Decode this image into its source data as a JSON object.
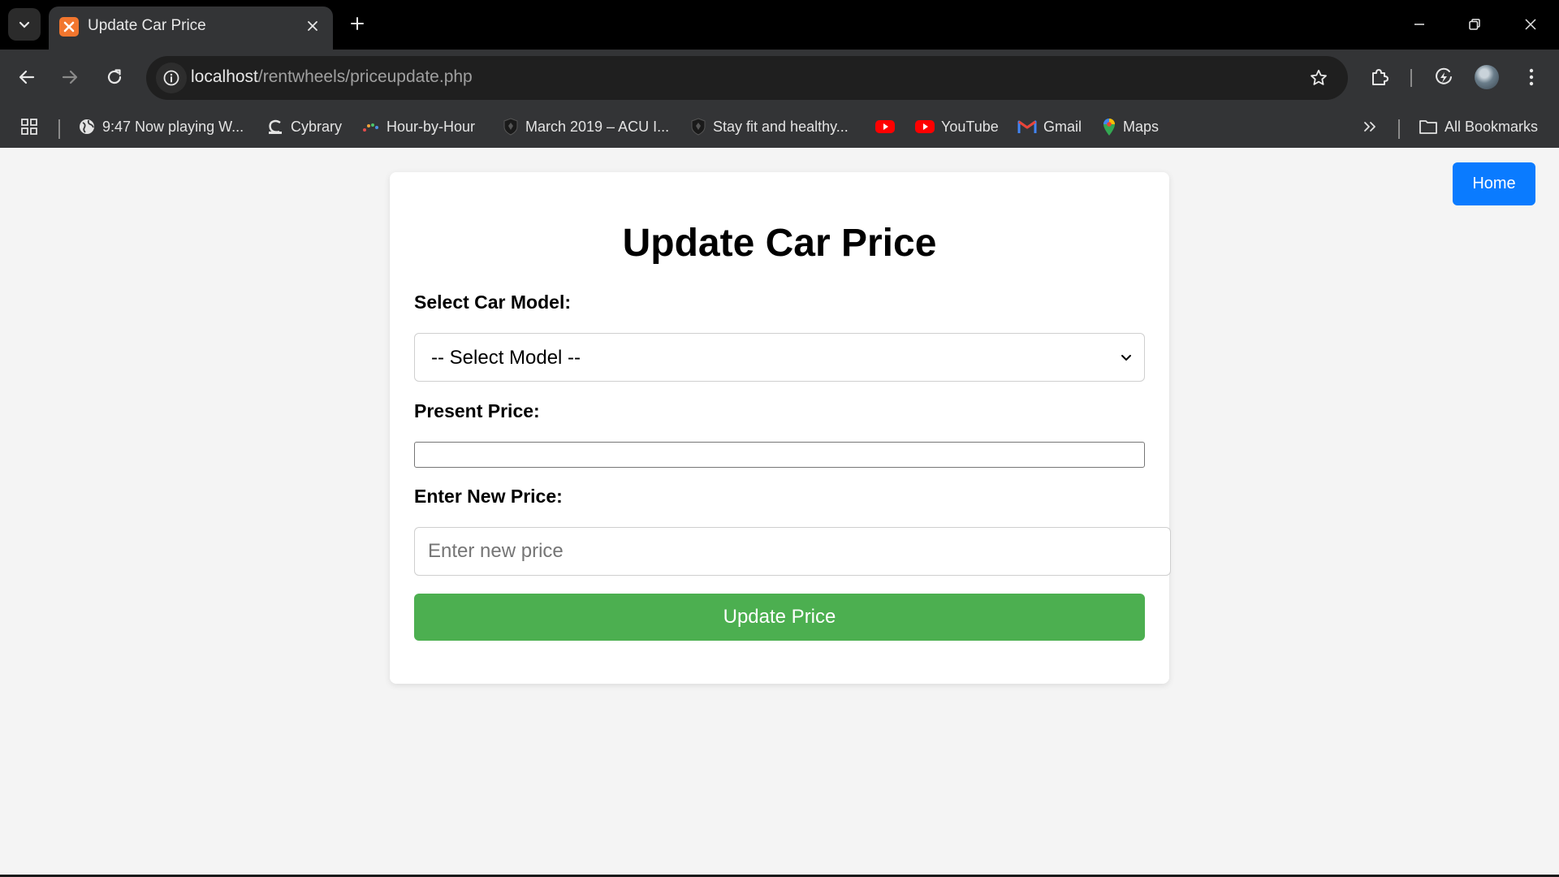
{
  "browser": {
    "tab_title": "Update Car Price",
    "url_host": "localhost",
    "url_path": "/rentwheels/priceupdate.php",
    "bookmarks": [
      {
        "label": "9:47 Now playing W...",
        "icon": "globe-icon"
      },
      {
        "label": "Cybrary",
        "icon": "cybrary-icon"
      },
      {
        "label": "Hour-by-Hour",
        "icon": "dots-icon"
      },
      {
        "label": "March 2019 – ACU I...",
        "icon": "shield-icon"
      },
      {
        "label": "Stay fit and healthy...",
        "icon": "shield-icon"
      },
      {
        "label": "",
        "icon": "youtube-icon"
      },
      {
        "label": "YouTube",
        "icon": "youtube-icon"
      },
      {
        "label": "Gmail",
        "icon": "gmail-icon"
      },
      {
        "label": "Maps",
        "icon": "maps-icon"
      }
    ],
    "all_bookmarks_label": "All Bookmarks",
    "colors": {
      "tab_bg": "#000000",
      "toolbar_bg": "#333436",
      "omnibox_bg": "#1f1f1f"
    }
  },
  "page": {
    "home_label": "Home",
    "title": "Update Car Price",
    "select_label": "Select Car Model:",
    "select_value": "-- Select Model --",
    "present_label": "Present Price:",
    "present_value": "",
    "new_label": "Enter New Price:",
    "new_placeholder": "Enter new price",
    "submit_label": "Update Price",
    "colors": {
      "home_button": "#0a7bff",
      "submit_button": "#4caf50",
      "page_bg": "#f4f4f4"
    }
  }
}
